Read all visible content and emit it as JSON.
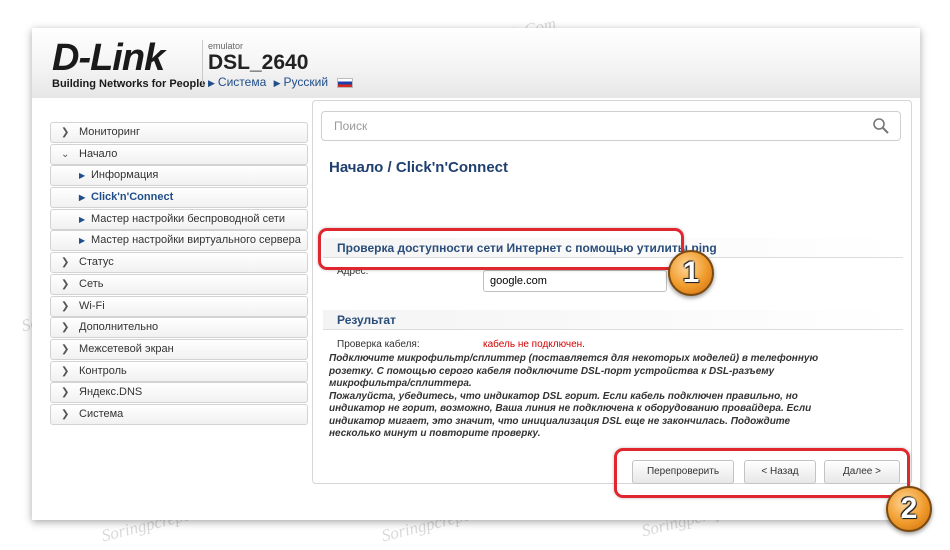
{
  "header": {
    "logo_text": "D-Link",
    "logo_tagline": "Building Networks for People",
    "product_label": "emulator",
    "product_name": "DSL_2640",
    "link_system": "Система",
    "link_language": "Русский"
  },
  "sidebar": {
    "items": [
      {
        "label": "Мониторинг",
        "icon": "chevron-right-circle-icon"
      },
      {
        "label": "Начало",
        "icon": "chevron-down-circle-icon"
      },
      {
        "label": "Информация",
        "icon": "triangle-right-icon"
      },
      {
        "label": "Click'n'Connect",
        "icon": "triangle-right-icon"
      },
      {
        "label": "Мастер настройки беспроводной сети",
        "icon": "triangle-right-icon"
      },
      {
        "label": "Мастер настройки виртуального сервера",
        "icon": "triangle-right-icon"
      },
      {
        "label": "Статус",
        "icon": "chevron-right-circle-icon"
      },
      {
        "label": "Сеть",
        "icon": "chevron-right-circle-icon"
      },
      {
        "label": "Wi-Fi",
        "icon": "chevron-right-circle-icon"
      },
      {
        "label": "Дополнительно",
        "icon": "chevron-right-circle-icon"
      },
      {
        "label": "Межсетевой экран",
        "icon": "chevron-right-circle-icon"
      },
      {
        "label": "Контроль",
        "icon": "chevron-right-circle-icon"
      },
      {
        "label": "Яндекс.DNS",
        "icon": "chevron-right-circle-icon"
      },
      {
        "label": "Система",
        "icon": "chevron-right-circle-icon"
      }
    ]
  },
  "search": {
    "placeholder": "Поиск",
    "icon": "search-icon"
  },
  "main": {
    "breadcrumb_parent": "Начало /",
    "breadcrumb_current": "Click'n'Connect",
    "ping_section_title": "Проверка доступности сети Интернет с помощью утилиты ping",
    "address_label": "Адрес:",
    "address_value": "google.com",
    "result_title": "Результат",
    "cable_check_label": "Проверка кабеля:",
    "cable_check_status": "кабель не подключен.",
    "info_lines": [
      "Подключите микрофильтр/сплиттер (поставляется для некоторых моделей) в телефонную",
      "розетку. С помощью серого кабеля подключите DSL-порт устройства к DSL-разъему",
      "микрофильтра/сплиттера.",
      "Пожалуйста, убедитесь, что индикатор DSL горит. Если кабель подключен правильно, но",
      "индикатор не горит, возможно, Ваша линия не подключена к оборудованию провайдера. Если",
      "индикатор мигает, это значит, что инициализация DSL еще не закончилась. Подождите",
      "несколько минут и повторите проверку."
    ]
  },
  "buttons": {
    "recheck": "Перепроверить",
    "back": "< Назад",
    "next": "Далее >"
  },
  "annotations": {
    "badge_1": "1",
    "badge_2": "2",
    "callout_color": "#e0262f",
    "badge_color": "#f09a2a"
  },
  "watermark_text": "Soringpcrepair.Com",
  "colors": {
    "accent": "#1f4e8a",
    "title": "#1f3f6f",
    "error": "#d40000"
  }
}
